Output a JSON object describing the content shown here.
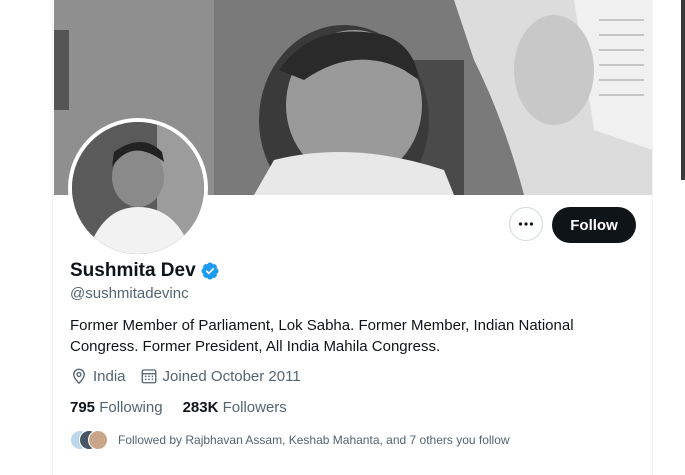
{
  "profile": {
    "display_name": "Sushmita Dev",
    "handle": "@sushmitadevinc",
    "bio": "Former Member of Parliament, Lok Sabha. Former Member, Indian National Congress. Former President, All India Mahila Congress.",
    "location": "India",
    "joined": "Joined October 2011",
    "following_count": "795",
    "following_label": "Following",
    "followers_count": "283K",
    "followers_label": "Followers",
    "followed_by": "Followed by Rajbhavan Assam, Keshab Mahanta, and 7 others you follow"
  },
  "actions": {
    "follow_label": "Follow"
  },
  "colors": {
    "verified": "#1d9bf0",
    "follow_bg": "#0f1419",
    "secondary_text": "#536471"
  },
  "icons": {
    "more": "ellipsis-icon",
    "verified": "verified-badge-icon",
    "location": "location-pin-icon",
    "calendar": "calendar-icon"
  }
}
